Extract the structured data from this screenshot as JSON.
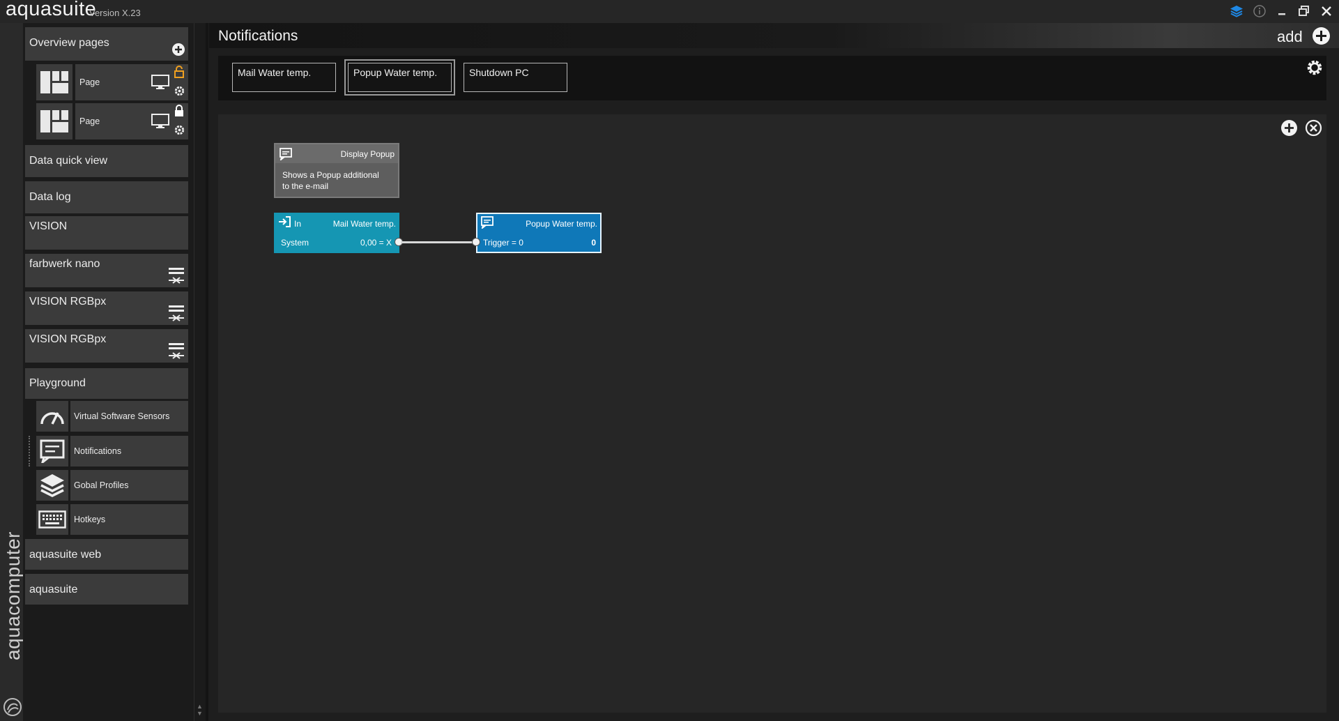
{
  "app": {
    "name": "aquasuite",
    "version": "Version X.23",
    "brand": "aquacomputer"
  },
  "window_controls": [
    "layers-icon",
    "info-icon",
    "minimize-icon",
    "restore-icon",
    "close-icon"
  ],
  "sidebar": {
    "overview": {
      "label": "Overview pages",
      "pages": [
        {
          "label": "Page",
          "lock": "unlocked",
          "lock_color": "#f0a020"
        },
        {
          "label": "Page",
          "lock": "locked",
          "lock_color": "#ffffff"
        }
      ]
    },
    "items": [
      {
        "label": "Data quick view"
      },
      {
        "label": "Data log"
      },
      {
        "label": "VISION"
      },
      {
        "label": "farbwerk nano"
      },
      {
        "label": "VISION RGBpx"
      },
      {
        "label": "VISION RGBpx"
      }
    ],
    "playground": {
      "label": "Playground",
      "children": [
        {
          "label": "Virtual Software Sensors",
          "icon": "gauge-icon"
        },
        {
          "label": "Notifications",
          "icon": "message-icon"
        },
        {
          "label": "Gobal Profiles",
          "icon": "layers-icon"
        },
        {
          "label": "Hotkeys",
          "icon": "keyboard-icon"
        }
      ]
    },
    "bottom_items": [
      {
        "label": "aquasuite web"
      },
      {
        "label": "aquasuite"
      }
    ]
  },
  "main": {
    "title": "Notifications",
    "add_label": "add",
    "tabs": [
      {
        "label": "Mail Water temp.",
        "active": false
      },
      {
        "label": "Popup Water temp.",
        "active": true
      },
      {
        "label": "Shutdown PC",
        "active": false
      }
    ],
    "nodes": {
      "info": {
        "title": "Display Popup",
        "description_line1": "Shows a Popup additional",
        "description_line2": "to the e-mail"
      },
      "input": {
        "tag": "In",
        "title": "Mail Water temp.",
        "source": "System",
        "value": "0,00 = X",
        "color": "#1596b3"
      },
      "popup": {
        "title": "Popup Water temp.",
        "trigger": "Trigger = 0",
        "value": "0",
        "color": "#0f78b8"
      }
    }
  },
  "colors": {
    "accent_blue": "#1e88e5",
    "lock_orange": "#f0a020"
  }
}
